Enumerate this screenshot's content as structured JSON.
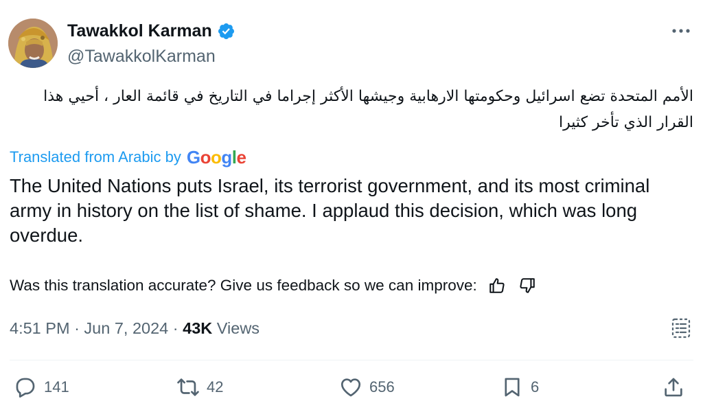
{
  "author": {
    "name": "Tawakkol Karman",
    "handle": "@TawakkolKarman",
    "verified": true
  },
  "tweet": {
    "original_text": "الأمم المتحدة تضع اسرائيل وحكومتها الارهابية وجيشها الأكثر إجراما في التاريخ في قائمة العار ، أحيي هذا القرار الذي تأخر كثيرا",
    "translated_from_label": "Translated from Arabic by",
    "translator_brand": [
      "G",
      "o",
      "o",
      "g",
      "l",
      "e"
    ],
    "translation": "The United Nations puts Israel, its terrorist government, and its most criminal army in history on the list of shame. I applaud this decision, which was long overdue.",
    "feedback_prompt": "Was this translation accurate? Give us feedback so we can improve:"
  },
  "meta": {
    "time": "4:51 PM",
    "separator": "·",
    "date": "Jun 7, 2024",
    "views_count": "43K",
    "views_label": "Views"
  },
  "actions": {
    "replies": "141",
    "reposts": "42",
    "likes": "656",
    "bookmarks": "6"
  },
  "icons": {
    "verified": "verified-badge-icon",
    "more": "more-options-icon",
    "thumbs_up": "thumbs-up-icon",
    "thumbs_down": "thumbs-down-icon",
    "analytics": "view-analytics-icon",
    "reply": "reply-icon",
    "repost": "repost-icon",
    "like": "heart-icon",
    "bookmark": "bookmark-icon",
    "share": "share-icon"
  },
  "colors": {
    "text": "#0f1419",
    "secondary": "#536471",
    "link": "#1d9bf0",
    "verified": "#1d9bf0"
  }
}
